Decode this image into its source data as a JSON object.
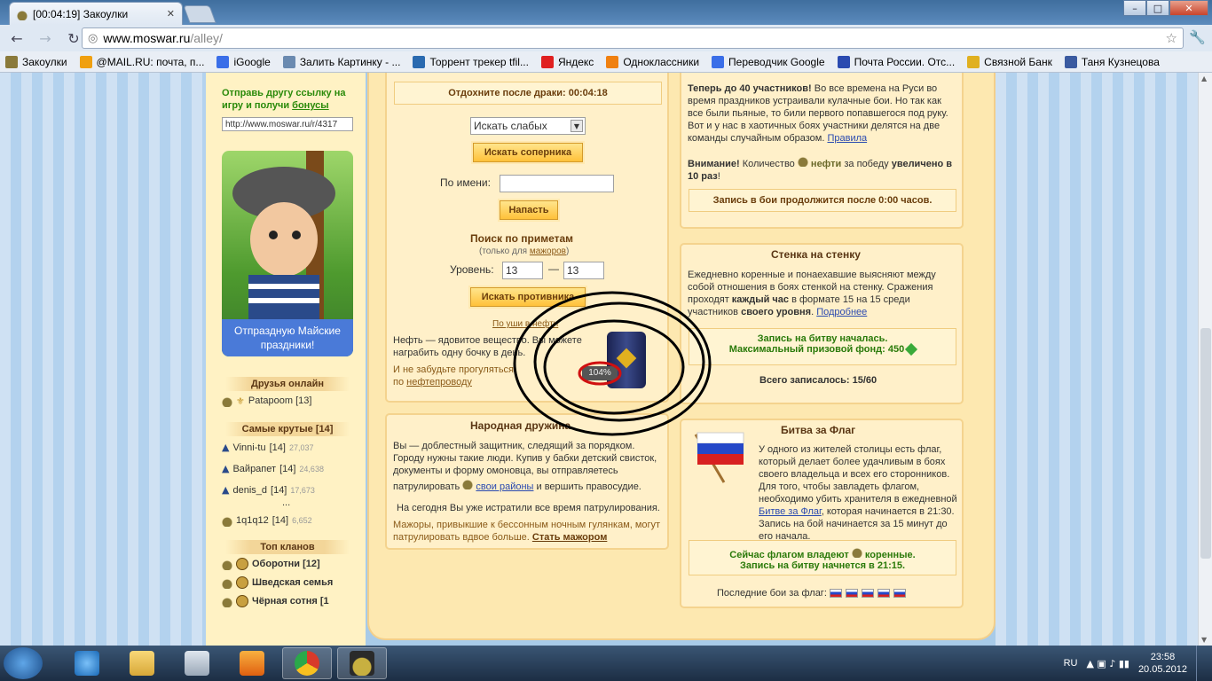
{
  "browser": {
    "tab_title": "[00:04:19] Закоулки",
    "url_host": "www.moswar.ru",
    "url_path": "/alley/",
    "bookmarks": [
      {
        "label": "Закоулки",
        "color": "#8a7a3a"
      },
      {
        "label": "@MAIL.RU: почта, п...",
        "color": "#f0a010"
      },
      {
        "label": "iGoogle",
        "color": "#3a6ee8"
      },
      {
        "label": "Залить Картинку - ...",
        "color": "#6a8ab0"
      },
      {
        "label": "Торрент трекер tfil...",
        "color": "#2a6ab0"
      },
      {
        "label": "Яндекс",
        "color": "#e02020"
      },
      {
        "label": "Одноклассники",
        "color": "#f08010"
      },
      {
        "label": "Переводчик Google",
        "color": "#3a6ee8"
      },
      {
        "label": "Почта России. Отс...",
        "color": "#2a4ab0"
      },
      {
        "label": "Связной Банк",
        "color": "#e0b020"
      },
      {
        "label": "Таня Кузнецова",
        "color": "#3a5aa0"
      }
    ]
  },
  "left": {
    "invite_text": "Отправь другу ссылку на игру и получи",
    "invite_link": "бонусы",
    "ref_value": "http://www.moswar.ru/r/4317",
    "promo": "Отпраздную Майские праздники!",
    "friends_header": "Друзья онлайн",
    "friends": [
      {
        "name": "Patapoom [13]"
      }
    ],
    "top_header": "Самые крутые [14]",
    "top": [
      {
        "name": "Vinni-tu",
        "level": "[14]",
        "score": "27,037"
      },
      {
        "name": "Вайрапет",
        "level": "[14]",
        "score": "24,638"
      },
      {
        "name": "denis_d",
        "level": "[14]",
        "score": "17,673"
      }
    ],
    "ellipsis": "...",
    "self": {
      "name": "1q1q12",
      "level": "[14]",
      "score": "6,652"
    },
    "clans_header": "Топ кланов",
    "clans": [
      {
        "name": "Оборотни [12]"
      },
      {
        "name": "Шведская семья"
      },
      {
        "name": "Чёрная сотня [1"
      }
    ]
  },
  "fight": {
    "rest": "Отдохните после драки: 00:04:18",
    "select_value": "Искать слабых",
    "search_btn": "Искать соперника",
    "byname_label": "По имени:",
    "attack_btn": "Напасть",
    "signs_title": "Поиск по приметам",
    "signs_sub_pre": "(только для ",
    "signs_sub_link": "мажоров",
    "signs_sub_post": ")",
    "level_label": "Уровень:",
    "level_from": "13",
    "level_to": "13",
    "level_dash": "—",
    "search_opp_btn": "Искать противника",
    "oil_link": "По уши в нефти",
    "oil_text": "Нефть — ядовитое вещество. Вы можете награбить одну бочку в день.",
    "oil_forget": "И не забудьте прогуляться",
    "oil_forget2_pre": "по ",
    "oil_forget2_link": "нефтепроводу",
    "barrel_pct": "104%"
  },
  "druzhina": {
    "title": "Народная дружина",
    "text": "Вы — доблестный защитник, следящий за порядком. Городу нужны такие люди. Купив у бабки детский свисток, документы и форму омоновца, вы отправляетесь патрулировать",
    "districts_link": "свои районы",
    "text_end": "и вершить правосудие.",
    "today": "На сегодня Вы уже истратили все время патрулирования.",
    "majors": "Мажоры, привыкшие к бессонным ночным гулянкам, могут патрулировать вдвое больше.",
    "become": "Стать мажором"
  },
  "chaotic": {
    "text_bold": "Теперь до 40 участников!",
    "text": "Во все времена на Руси во время праздников устраивали кулачные бои. Но так как все были пьяные, то били первого попавшегося под руку. Вот и у нас в хаотичных боях участники делятся на две команды случайным образом.",
    "rules": "Правила",
    "attn": "Внимание!",
    "attn_text": "Количество",
    "oil_word": "нефти",
    "attn_text2": "за победу",
    "increased": "увеличено в 10 раз",
    "bang": "!",
    "signup": "Запись в бои продолжится после 0:00 часов."
  },
  "wall": {
    "title": "Стенка на стенку",
    "text1": "Ежедневно коренные и понаехавшие выясняют между собой отношения в боях стенкой на стенку. Сражения проходят",
    "every_hour": "каждый час",
    "text2": "в формате 15 на 15 среди участников",
    "own_level": "своего уровня",
    "more": "Подробнее",
    "signup1": "Запись на битву началась.",
    "signup2": "Максимальный призовой фонд:",
    "prize": "450",
    "total": "Всего записалось: 15/60"
  },
  "flag": {
    "title": "Битва за Флаг",
    "text": "У одного из жителей столицы есть флаг, который делает более удачливым в боях своего владельца и всех его сторонников. Для того, чтобы завладеть флагом, необходимо убить хранителя в ежедневной",
    "link": "Битве за Флаг",
    "text2": ", которая начинается в 21:30. Запись на бой начинается за 15 минут до его начала.",
    "owner_pre": "Сейчас флагом владеют",
    "owner": "коренные.",
    "signup": "Запись на битву начнется в 21:15.",
    "last": "Последние бои за флаг:"
  },
  "taskbar": {
    "lang": "RU",
    "time": "23:58",
    "date": "20.05.2012"
  }
}
